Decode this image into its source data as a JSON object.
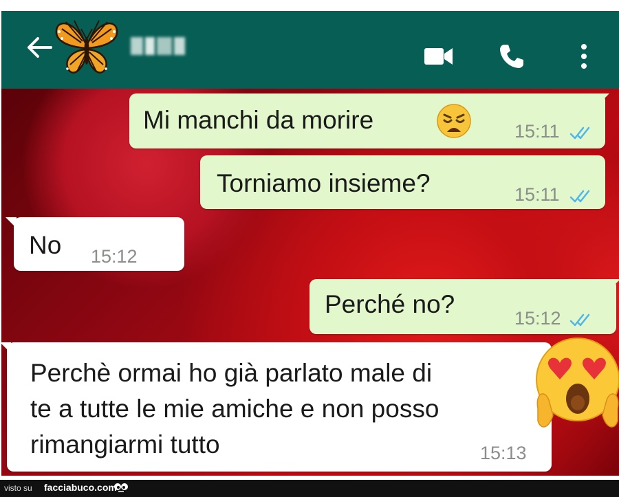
{
  "header": {
    "back_icon": "back-arrow-icon",
    "avatar": "butterfly-avatar",
    "contact_name_blurred": true,
    "icons": [
      "video-call-icon",
      "phone-call-icon",
      "more-vert-icon"
    ],
    "color": "#075e55"
  },
  "messages": [
    {
      "direction": "outgoing",
      "text": "Mi manchi da morire",
      "emoji": "weary-face-emoji",
      "time": "15:11",
      "status": "read"
    },
    {
      "direction": "outgoing",
      "text": "Torniamo insieme?",
      "time": "15:11",
      "status": "read"
    },
    {
      "direction": "incoming",
      "text": "No",
      "time": "15:12"
    },
    {
      "direction": "outgoing",
      "text": "Perché no?",
      "time": "15:12",
      "status": "read"
    },
    {
      "direction": "incoming",
      "lines": [
        "Perchè ormai ho già parlato male di",
        "te a tutte le mie amiche e non posso",
        "rimangiarmi tutto"
      ],
      "time": "15:13"
    }
  ],
  "overlay_emoji": "heart-eyes-screaming-face-emoji",
  "footer": {
    "prefix": "visto su",
    "brand": "facciabuco.com"
  },
  "colors": {
    "outgoing_bubble": "#e2f7cb",
    "incoming_bubble": "#ffffff",
    "read_ticks": "#4fb6ec",
    "wallpaper": "#b80a12"
  }
}
